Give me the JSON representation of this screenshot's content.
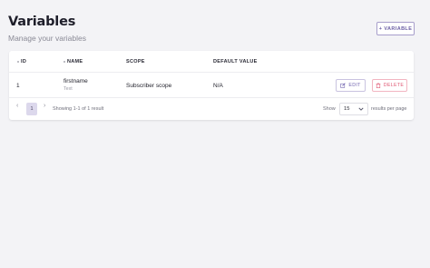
{
  "header": {
    "title": "Variables",
    "subtitle": "Manage your variables",
    "add_button_label": "VARIABLE",
    "add_button_icon": "+"
  },
  "table": {
    "columns": [
      "ID",
      "NAME",
      "SCOPE",
      "DEFAULT VALUE"
    ],
    "rows": [
      {
        "id": "1",
        "name": "firstname",
        "type": "Text",
        "scope": "Subscriber scope",
        "default_value": "N/A",
        "edit_label": "EDIT",
        "delete_label": "DELETE"
      }
    ]
  },
  "pagination": {
    "prev": "‹",
    "current_page": "1",
    "next": "›",
    "summary": "Showing 1-1 of 1 result",
    "show_label": "Show",
    "per_page_value": "15",
    "per_page_suffix": "results per page"
  },
  "colors": {
    "accent": "#6b5fa5",
    "danger": "#e05a76",
    "background": "#f3f3f6"
  }
}
